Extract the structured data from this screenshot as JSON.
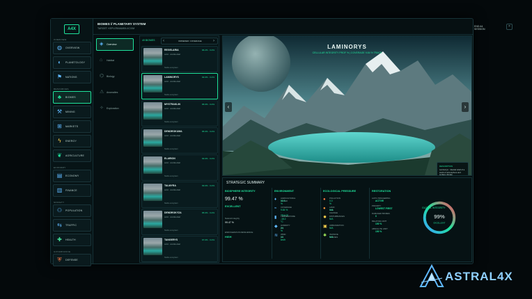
{
  "nav": {
    "logo": "A4X",
    "sections": [
      {
        "title": "OVERVIEW",
        "items": [
          {
            "label": "OVERVIEW",
            "icon": "globe-icon"
          },
          {
            "label": "PLANETOLOGY",
            "icon": "planet-icon"
          },
          {
            "label": "NATIONS",
            "icon": "flag-icon"
          }
        ]
      },
      {
        "title": "RESOURCES",
        "items": [
          {
            "label": "BIOMES",
            "icon": "tree-icon",
            "active": true
          },
          {
            "label": "MINING",
            "icon": "pickaxe-icon"
          },
          {
            "label": "MARKETS",
            "icon": "cart-icon"
          },
          {
            "label": "ENERGY",
            "icon": "bolt-icon"
          },
          {
            "label": "AGRICULTURE",
            "icon": "leaf-icon"
          }
        ]
      },
      {
        "title": "ECONOMY",
        "items": [
          {
            "label": "ECONOMY",
            "icon": "chart-icon"
          },
          {
            "label": "FINANCE",
            "icon": "bank-icon"
          }
        ]
      },
      {
        "title": "SOCIETY",
        "items": [
          {
            "label": "POPULATION",
            "icon": "people-icon"
          },
          {
            "label": "TRAFFIC",
            "icon": "route-icon"
          },
          {
            "label": "HEALTH",
            "icon": "cross-icon"
          }
        ]
      },
      {
        "title": "GOVERNANCE",
        "items": [
          {
            "label": "DEFENSE",
            "icon": "shield-icon"
          }
        ]
      }
    ]
  },
  "header": {
    "breadcrumb": "BIOMES // PLANETARY SYSTEM",
    "target": "TARGET: KEPLERAMARA 4C/XM",
    "end_session": "END A4 SESSION",
    "close": "×"
  },
  "subnav": [
    {
      "label": "Overview",
      "icon": "layers-icon",
      "active": true
    },
    {
      "label": "Habitat",
      "icon": "home-icon"
    },
    {
      "label": "Biology",
      "icon": "dna-icon"
    },
    {
      "label": "Anomalies",
      "icon": "warning-icon"
    },
    {
      "label": "Exploration",
      "icon": "compass-icon"
    }
  ],
  "biome_list": {
    "count_label": "49 BIOMES",
    "sort_label": "ORDERED: COVERAGE",
    "items": [
      {
        "name": "REGELARIA",
        "stat": "96.2% · 0.4%",
        "class": "cold · continental",
        "footer": "Stable ecosystem"
      },
      {
        "name": "LAMINORYS",
        "stat": "93.0% · 0.4%",
        "class": "cold · continental",
        "footer": "Stable ecosystem",
        "active": true
      },
      {
        "name": "MYSTRAKLIN",
        "stat": "95.0% · 0.4%",
        "class": "cold · continental",
        "footer": "Stable ecosystem"
      },
      {
        "name": "DENDROKUMA",
        "stat": "95.0% · 0.4%",
        "class": "cold · continental",
        "footer": "Stable ecosystem"
      },
      {
        "name": "ELARION",
        "stat": "93.0% · 0.4%",
        "class": "cold · continental",
        "footer": "Stable ecosystem"
      },
      {
        "name": "TALMYRA",
        "stat": "93.0% · 0.2%",
        "class": "cold · continental",
        "footer": "Stable ecosystem"
      },
      {
        "name": "DENDROKYZA",
        "stat": "95.0% · 0.2%",
        "class": "cold · continental",
        "footer": "Stable ecosystem"
      },
      {
        "name": "TANGERYS",
        "stat": "97.0% · 0.4%",
        "class": "cold · continental",
        "footer": "Stable ecosystem"
      }
    ]
  },
  "hero": {
    "title": "LAMINORYS",
    "subtitle": "CELLULAR INTEGRITY PROF %  |  COVERAGE 9.84 % TRACE",
    "prev": "‹",
    "next": "›",
    "desc_title": "DESCRIPTION",
    "desc_body": "Laminorys · Glacial relief of a world of atmosphere and surface climate"
  },
  "summary": {
    "title": "STRATEGIC SUMMARY",
    "biosphere": {
      "header": "BIOSPHERE INTEGRITY",
      "value": "99.47 %",
      "status": "EXCELLENT",
      "l1": "Natural integrity",
      "v1": "99.47 %",
      "l2": "ENDOGENOUS RESILIENCE",
      "v2": "HIGH"
    },
    "environment": {
      "header": "ENVIRONMENT",
      "rows": [
        {
          "icon": "drop-icon",
          "label": "AGRICULTURAL WATER",
          "value": "93.8 %"
        },
        {
          "icon": "wave-icon",
          "label": "COVERAGE",
          "value": "9.84 % · TRACE"
        },
        {
          "icon": "thermometer-icon",
          "label": "TEMPERATURE",
          "value": "-18.2 °C"
        },
        {
          "icon": "humidity-icon",
          "label": "HUMIDITY (%)",
          "value": "24 %"
        },
        {
          "icon": "wind-icon",
          "label": "WIND (%)",
          "value": "12 km/h"
        }
      ]
    },
    "pressure": {
      "header": "ECOLOGICAL PRESSURE",
      "rows": [
        {
          "icon": "factory-icon",
          "label": "POLLUTION",
          "value": "0.0 %"
        },
        {
          "icon": "axe-icon",
          "label": "LAND USE CHANGE",
          "value": "N/A"
        },
        {
          "icon": "gear-icon",
          "label": "DISTURBANCES",
          "value": "N/A"
        },
        {
          "icon": "city-icon",
          "label": "URBANIZATION",
          "value": "N/A"
        },
        {
          "icon": "bug-icon",
          "label": "INVASIVE SPECIES",
          "value": "N/A"
        }
      ]
    },
    "restoration": {
      "header": "RESTORATION",
      "rows": [
        {
          "label": "AUTO-TRIGGERING",
          "value": "ACTIVE"
        },
        {
          "label": "PRIORITY",
          "value": "LOWEST FIRST"
        },
        {
          "label": "DAMAGED BIOMES",
          "value": "0"
        },
        {
          "label": "RELATIVE LIMIT",
          "value": "100 %"
        },
        {
          "label": "ABSOLUTE LIMIT",
          "value": "100 %"
        }
      ]
    },
    "global": {
      "header": "GLOBAL INTEGRITY",
      "value": "99%",
      "status": "EXCELLENT",
      "fraction": 0.99
    }
  },
  "brand": {
    "main": "ASTRAL",
    "accent": "4X"
  },
  "colors": {
    "accent": "#1fe39c",
    "panel": "#061012",
    "border": "#143035"
  }
}
